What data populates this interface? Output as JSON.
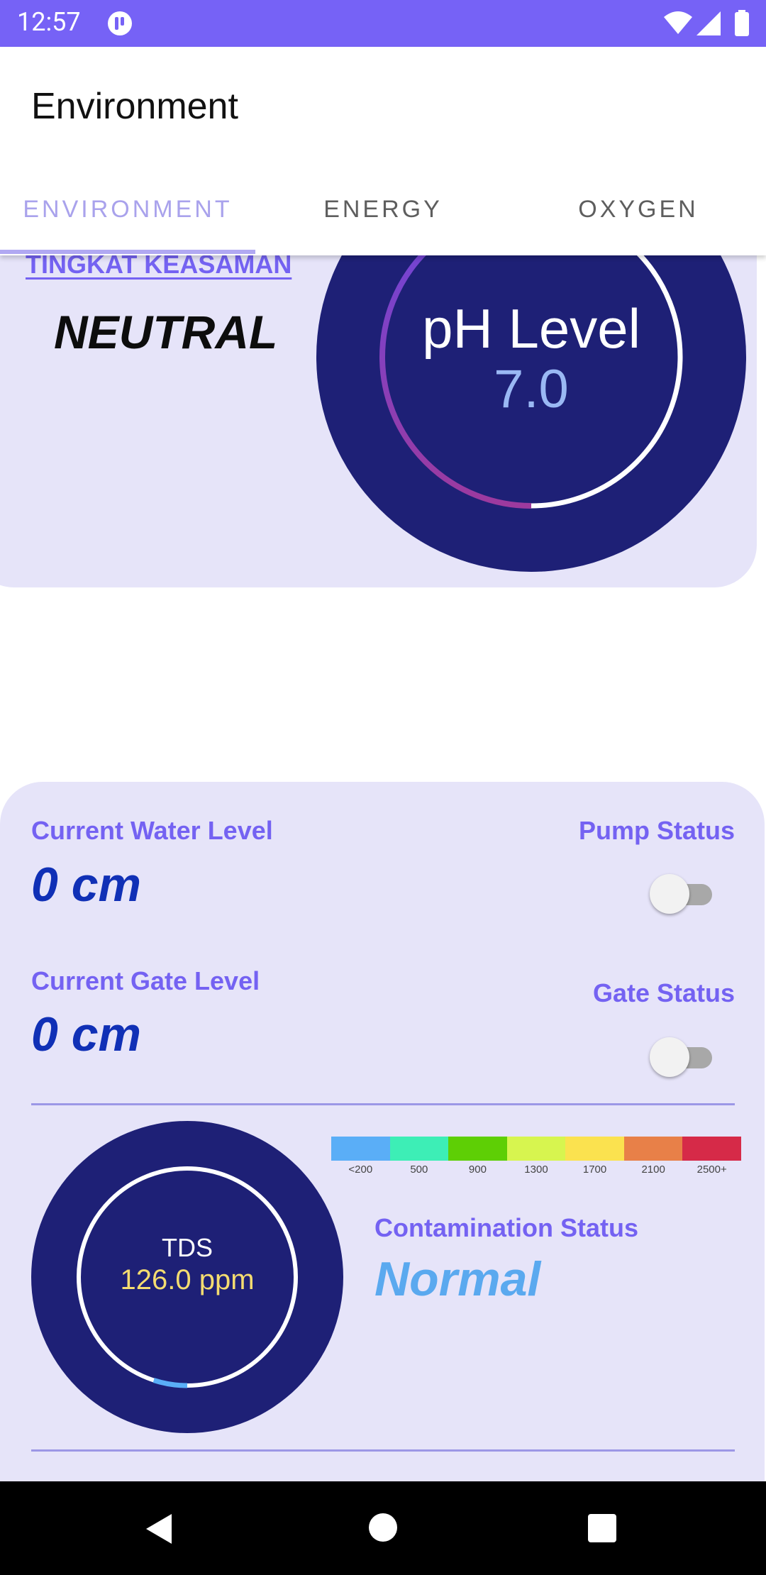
{
  "status_bar": {
    "time": "12:57",
    "icons": [
      "app-notification-icon",
      "wifi-icon",
      "cell-signal-icon",
      "battery-icon"
    ]
  },
  "app_bar": {
    "title": "Environment"
  },
  "tabs": [
    {
      "label": "ENVIRONMENT",
      "selected": true
    },
    {
      "label": "ENERGY",
      "selected": false
    },
    {
      "label": "OXYGEN",
      "selected": false
    }
  ],
  "ph": {
    "section_label": "TINGKAT KEASAMAN",
    "status": "NEUTRAL",
    "gauge_title": "pH Level",
    "value": "7.0",
    "gauge_fraction": 0.5
  },
  "water": {
    "water_level_label": "Current Water Level",
    "water_level_value": "0 cm",
    "pump_status_label": "Pump Status",
    "pump_on": false,
    "gate_level_label": "Current Gate Level",
    "gate_level_value": "0 cm",
    "gate_status_label": "Gate Status",
    "gate_on": false
  },
  "tds": {
    "label": "TDS",
    "value": "126.0 ppm",
    "gauge_fraction": 0.05,
    "scale": [
      {
        "label": "<200",
        "color": "#5aaef7"
      },
      {
        "label": "500",
        "color": "#3deeb6"
      },
      {
        "label": "900",
        "color": "#5ecf05"
      },
      {
        "label": "1300",
        "color": "#d7f54f"
      },
      {
        "label": "1700",
        "color": "#fbe24f"
      },
      {
        "label": "2100",
        "color": "#e88048"
      },
      {
        "label": "2500+",
        "color": "#d62a48"
      }
    ],
    "contamination_label": "Contamination Status",
    "contamination_value": "Normal"
  },
  "colors": {
    "primary": "#7662f6",
    "gauge_bg": "#1e2076",
    "card_bg": "#e6e4f9"
  }
}
